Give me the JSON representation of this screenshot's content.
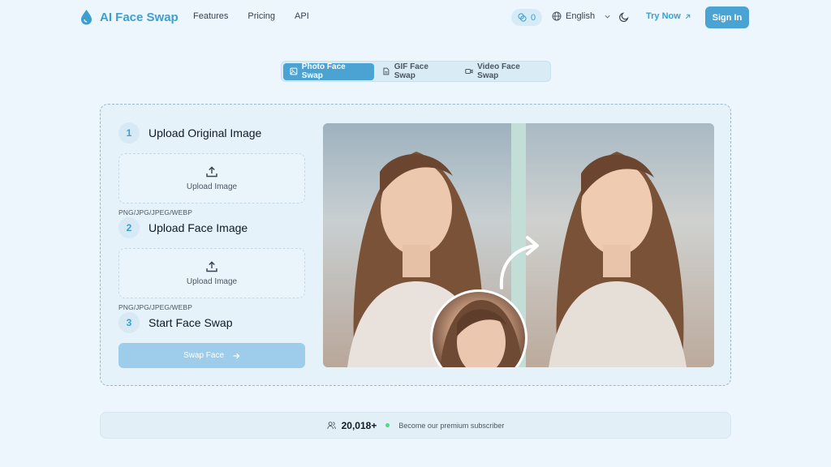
{
  "header": {
    "brand": "AI Face Swap",
    "nav": [
      "Features",
      "Pricing",
      "API"
    ],
    "credits": "0",
    "language": "English",
    "try_now": "Try Now",
    "sign_in": "Sign In"
  },
  "tabs": [
    {
      "label": "Photo Face Swap",
      "icon": "image-icon",
      "active": true
    },
    {
      "label": "GIF Face Swap",
      "icon": "file-icon",
      "active": false
    },
    {
      "label": "Video Face Swap",
      "icon": "video-icon",
      "active": false
    }
  ],
  "steps": [
    {
      "num": "1",
      "title": "Upload Original Image",
      "upload_label": "Upload Image",
      "formats": "PNG/JPG/JPEG/WEBP"
    },
    {
      "num": "2",
      "title": "Upload Face Image",
      "upload_label": "Upload Image",
      "formats": "PNG/JPG/JPEG/WEBP"
    },
    {
      "num": "3",
      "title": "Start Face Swap"
    }
  ],
  "swap_button": "Swap Face",
  "subscribers": {
    "count": "20,018+",
    "text": "Become our premium subscriber"
  },
  "colors": {
    "accent": "#4ba3d4",
    "background": "#ecf6fc"
  }
}
